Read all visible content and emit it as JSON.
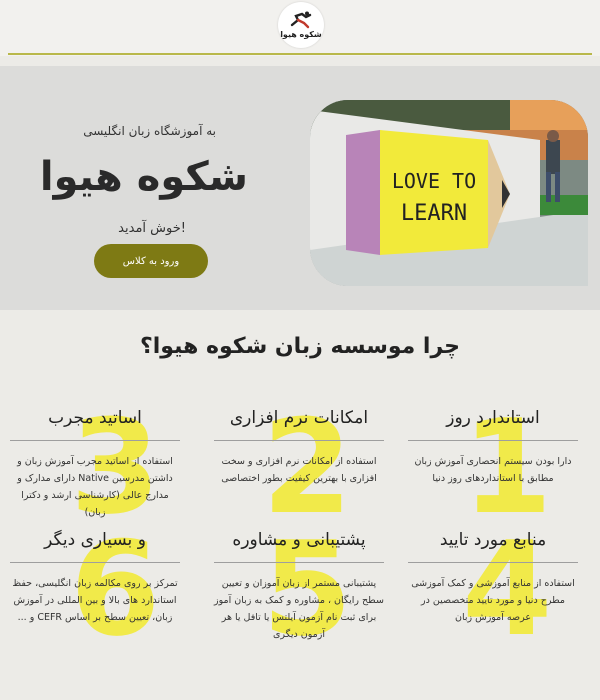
{
  "header": {
    "logo_text": "شکوه هیوا"
  },
  "hero": {
    "subtitle": "به آموزشگاه زبان انگلیسی",
    "title": "شکوه هیوا",
    "welcome": "خوش آمدید!",
    "cta_label": "ورود به کلاس",
    "image_text_line1": "LOVE TO",
    "image_text_line2": "LEARN"
  },
  "why_title": "چرا موسسه زبان شکوه هیوا؟",
  "features": [
    {
      "title": "استاندارد روز",
      "text": "دارا بودن سیستم انحصاری آموزش زبان مطابق با استانداردهای روز دنیا"
    },
    {
      "title": "امکانات نرم افزاری",
      "text": "استفاده از امکانات نرم افزاری و سخت افزاری با بهترین کیفیت بطور اختصاصی"
    },
    {
      "title": "اساتید مجرب",
      "text": "استفاده از اساتید مجرب آموزش زبان و داشتن مدرسین Native دارای مدارک و مدارج عالی (کارشناسی ارشد و دکترا زبان)"
    },
    {
      "title": "منابع مورد تایید",
      "text": "استفاده از منابع آموزشی و کمک آموزشی مطرح دنیا و مورد تایید متخصصین در عرصه آموزش زبان"
    },
    {
      "title": "پشتیبانی و مشاوره",
      "text": "پشتیبانی مستمر از زبان آموزان و تعیین سطح رایگان ، مشاوره و کمک به زبان آموز برای ثبت نام آزمون آیلتس یا تافل یا هر آزمون دیگری"
    },
    {
      "title": "و بسیاری دیگر",
      "text": "تمرکز بر روی مکالمه زبان انگلیسی، حفظ استاندارد های بالا و بین المللی در آموزش زبان، تعیین سطح بر اساس CEFR و ..."
    }
  ],
  "colors": {
    "accent": "#7e7a14",
    "hero_bg": "#dcdcda",
    "page_bg": "#ecebe7",
    "deco": "#f2ea3a"
  }
}
